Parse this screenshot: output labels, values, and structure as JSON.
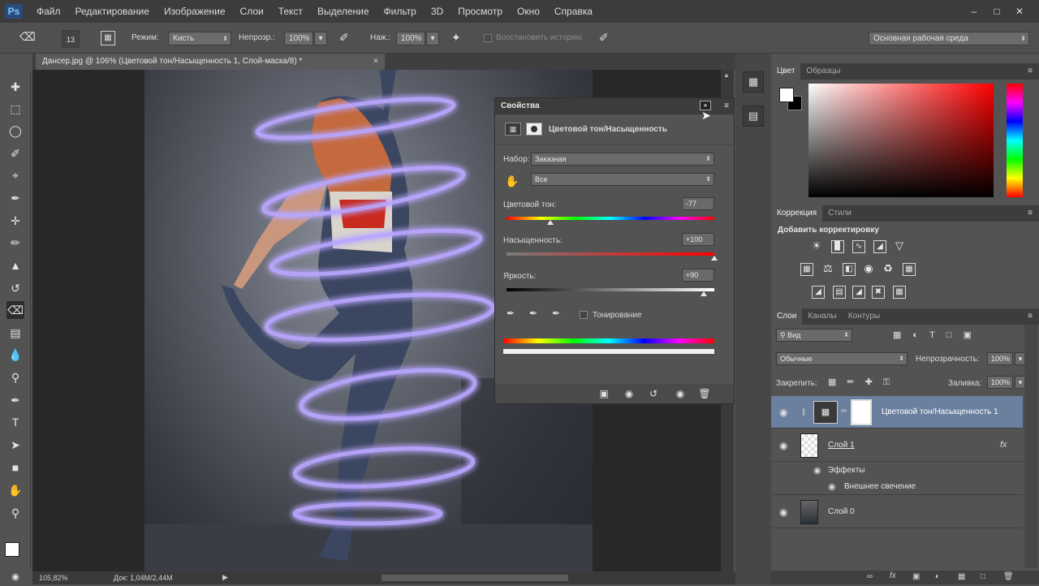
{
  "app": {
    "logo": "Ps"
  },
  "menu": [
    "Файл",
    "Редактирование",
    "Изображение",
    "Слои",
    "Текст",
    "Выделение",
    "Фильтр",
    "3D",
    "Просмотр",
    "Окно",
    "Справка"
  ],
  "options": {
    "brush_size": "13",
    "mode_label": "Режим:",
    "mode_value": "Кисть",
    "opacity_label": "Непрозр.:",
    "opacity_value": "100%",
    "flow_label": "Наж.:",
    "flow_value": "100%",
    "restore_history": "Восстановить историю",
    "workspace": "Основная рабочая среда"
  },
  "document": {
    "tab_title": "Дансер.jpg @ 106% (Цветовой тон/Насыщенность 1, Слой-маска/8) *",
    "zoom": "105,82%",
    "doc_size": "Док: 1,04M/2,44M"
  },
  "properties": {
    "title": "Свойства",
    "adjustment_name": "Цветовой тон/Насыщенность",
    "preset_label": "Набор:",
    "preset_value": "Заказная",
    "channel_value": "Все",
    "hue_label": "Цветовой тон:",
    "hue_value": "-77",
    "hue_level": 0.21,
    "saturation_label": "Насыщенность:",
    "saturation_value": "+100",
    "saturation_level": 1.0,
    "lightness_label": "Яркость:",
    "lightness_value": "+90",
    "lightness_level": 0.95,
    "colorize_label": "Тонирование",
    "colorize_checked": false
  },
  "color_panel": {
    "tabs": [
      "Цвет",
      "Образцы"
    ],
    "active_tab": 0,
    "hue_color": "#ff0000",
    "foreground": "#ffffff",
    "background": "#000000"
  },
  "adjustments_panel": {
    "tabs": [
      "Коррекция",
      "Стили"
    ],
    "active_tab": 0,
    "heading": "Добавить корректировку"
  },
  "layers_panel": {
    "tabs": [
      "Слои",
      "Каналы",
      "Контуры"
    ],
    "active_tab": 0,
    "filter_kind": "Вид",
    "blend_mode": "Обычные",
    "opacity_label": "Непрозрачность:",
    "opacity_value": "100%",
    "lock_label": "Закрепить:",
    "fill_label": "Заливка:",
    "fill_value": "100%",
    "layers": [
      {
        "name": "Цветовой тон/Насыщенность 1",
        "selected": true
      },
      {
        "name": "Слой 1",
        "fx": "fx",
        "effects_label": "Эффекты",
        "effect": "Внешнее свечение"
      },
      {
        "name": "Слой 0"
      }
    ]
  }
}
